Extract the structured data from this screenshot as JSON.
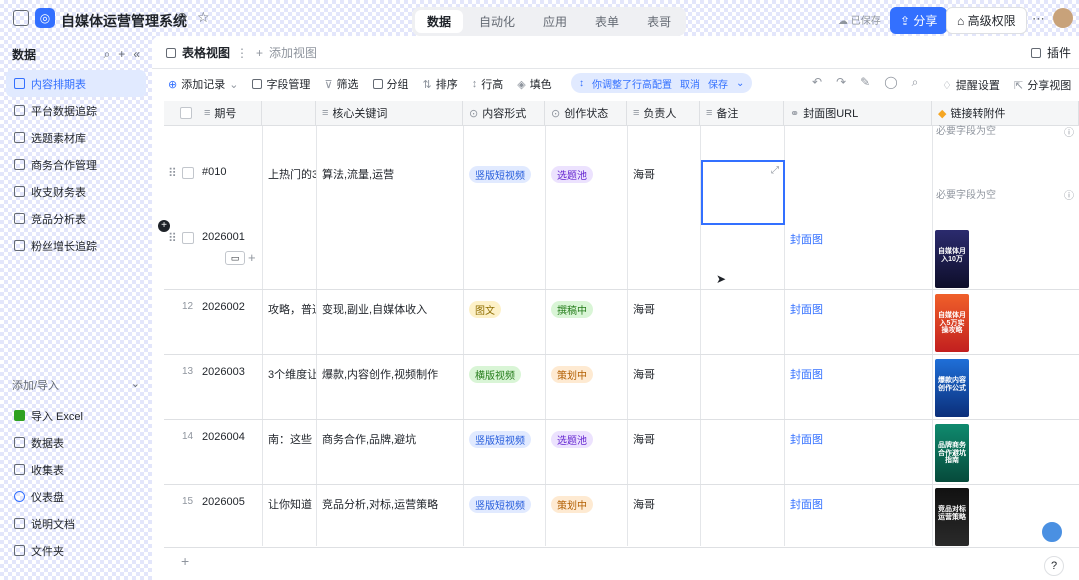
{
  "topbar": {
    "title": "自媒体运营管理系统",
    "tabs": [
      "数据",
      "自动化",
      "应用",
      "表单",
      "表哥"
    ],
    "saved": "已保存",
    "share": "分享",
    "advanced_perm": "高级权限"
  },
  "sidebar": {
    "header": "数据",
    "items": [
      {
        "label": "内容排期表",
        "active": true
      },
      {
        "label": "平台数据追踪"
      },
      {
        "label": "选题素材库"
      },
      {
        "label": "商务合作管理"
      },
      {
        "label": "收支财务表"
      },
      {
        "label": "竞品分析表"
      },
      {
        "label": "粉丝增长追踪"
      }
    ],
    "add_import": "添加/导入",
    "bottom_items": [
      "导入 Excel",
      "数据表",
      "收集表",
      "仪表盘",
      "说明文档",
      "文件夹"
    ]
  },
  "main": {
    "view_tab": "表格视图",
    "add_view": "添加视图",
    "plugins": "插件",
    "toolbar": {
      "add_record": "添加记录",
      "field_manage": "字段管理",
      "filter": "筛选",
      "group": "分组",
      "sort": "排序",
      "row_height": "行高",
      "fill_color": "填色",
      "notice": "你调整了行高配置",
      "cancel": "取消",
      "save": "保存",
      "remind_settings": "提醒设置",
      "share_view": "分享视图"
    },
    "columns": [
      "期号",
      "核心关键词",
      "内容形式",
      "创作状态",
      "负责人",
      "备注",
      "封面图URL",
      "链接转附件"
    ],
    "empty_hint": "必要字段为空",
    "rows": [
      {
        "num": "",
        "id": "#010",
        "title_frag": "上热门的3",
        "keywords": "算法,流量,运营",
        "form": "竖版短视频",
        "status": "选题池",
        "owner": "海哥",
        "cover": "",
        "thumb": ""
      },
      {
        "num": "",
        "id": "2026001",
        "title_frag": "",
        "keywords": "",
        "form": "",
        "status": "",
        "owner": "",
        "cover": "封面图",
        "thumb": "自媒体月入10万"
      },
      {
        "num": "12",
        "id": "2026002",
        "title_frag": "攻略，普通",
        "keywords": "变现,副业,自媒体收入",
        "form": "图文",
        "status": "撰稿中",
        "owner": "海哥",
        "cover": "封面图",
        "thumb": "自媒体月入5万实操攻略"
      },
      {
        "num": "13",
        "id": "2026003",
        "title_frag": "3个维度让",
        "keywords": "爆款,内容创作,视频制作",
        "form": "横版视频",
        "status": "策划中",
        "owner": "海哥",
        "cover": "封面图",
        "thumb": "爆款内容创作公式"
      },
      {
        "num": "14",
        "id": "2026004",
        "title_frag": "南：这些",
        "keywords": "商务合作,品牌,避坑",
        "form": "竖版短视频",
        "status": "选题池",
        "owner": "海哥",
        "cover": "封面图",
        "thumb": "品牌商务合作避坑指南"
      },
      {
        "num": "15",
        "id": "2026005",
        "title_frag": "让你知道",
        "keywords": "竞品分析,对标,运营策略",
        "form": "竖版短视频",
        "status": "策划中",
        "owner": "海哥",
        "cover": "封面图",
        "thumb": "竞品对标运营策略"
      }
    ],
    "add_row": "+"
  },
  "colors": {
    "accent": "#3370ff",
    "tag_blue": "#e1eaff",
    "tag_yellow": "#fdf1c8",
    "tag_green": "#d9f5d6",
    "tag_purple": "#ece2fe",
    "tag_orange": "#feead2"
  }
}
